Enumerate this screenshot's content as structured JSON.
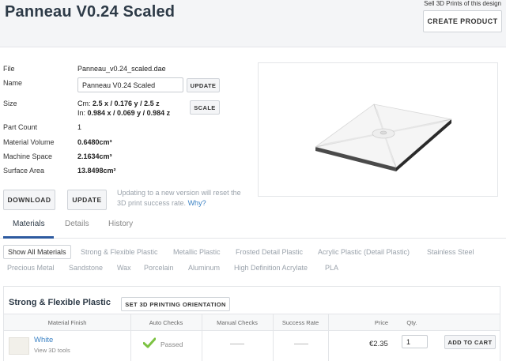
{
  "header": {
    "title": "Panneau V0.24 Scaled",
    "sell_text": "Sell 3D Prints of this design",
    "create_product": "CREATE PRODUCT"
  },
  "details": {
    "file_label": "File",
    "file_value": "Panneau_v0.24_scaled.dae",
    "name_label": "Name",
    "name_value": "Panneau V0.24 Scaled",
    "name_update": "UPDATE",
    "size_label": "Size",
    "size_cm_prefix": "Cm:",
    "size_cm": "2.5 x / 0.176 y / 2.5 z",
    "size_in_prefix": "In:",
    "size_in": "0.984 x / 0.069 y / 0.984 z",
    "scale_button": "SCALE",
    "part_count_label": "Part Count",
    "part_count_value": "1",
    "material_volume_label": "Material Volume",
    "material_volume_value": "0.6480cm³",
    "machine_space_label": "Machine Space",
    "machine_space_value": "2.1634cm³",
    "surface_area_label": "Surface Area",
    "surface_area_value": "13.8498cm²"
  },
  "actions": {
    "download": "DOWNLOAD",
    "update": "UPDATE",
    "note": "Updating to a new version will reset the 3D print success rate.",
    "why": "Why?"
  },
  "tabs": [
    "Materials",
    "Details",
    "History"
  ],
  "material_filters": {
    "row1": [
      "Show All Materials",
      "Strong & Flexible Plastic",
      "Metallic Plastic",
      "Frosted Detail Plastic",
      "Acrylic Plastic (Detail Plastic)",
      "Stainless Steel"
    ],
    "row2": [
      "Precious Metal",
      "Sandstone",
      "Wax",
      "Porcelain",
      "Aluminum",
      "High Definition Acrylate",
      "PLA"
    ]
  },
  "panel": {
    "title": "Strong & Flexible Plastic",
    "orientation_button": "SET 3D PRINTING ORIENTATION",
    "columns": [
      "Material Finish",
      "Auto Checks",
      "Manual Checks",
      "Success Rate",
      "Price",
      "Qty."
    ],
    "row": {
      "finish": "White",
      "view_tools": "View 3D tools",
      "auto_check": "Passed",
      "price": "€2.35",
      "qty": "1",
      "add_to_cart": "ADD TO CART"
    }
  },
  "colors": {
    "accent": "#2d5aa0",
    "link": "#3b82c4",
    "passed": "#7cc242"
  }
}
